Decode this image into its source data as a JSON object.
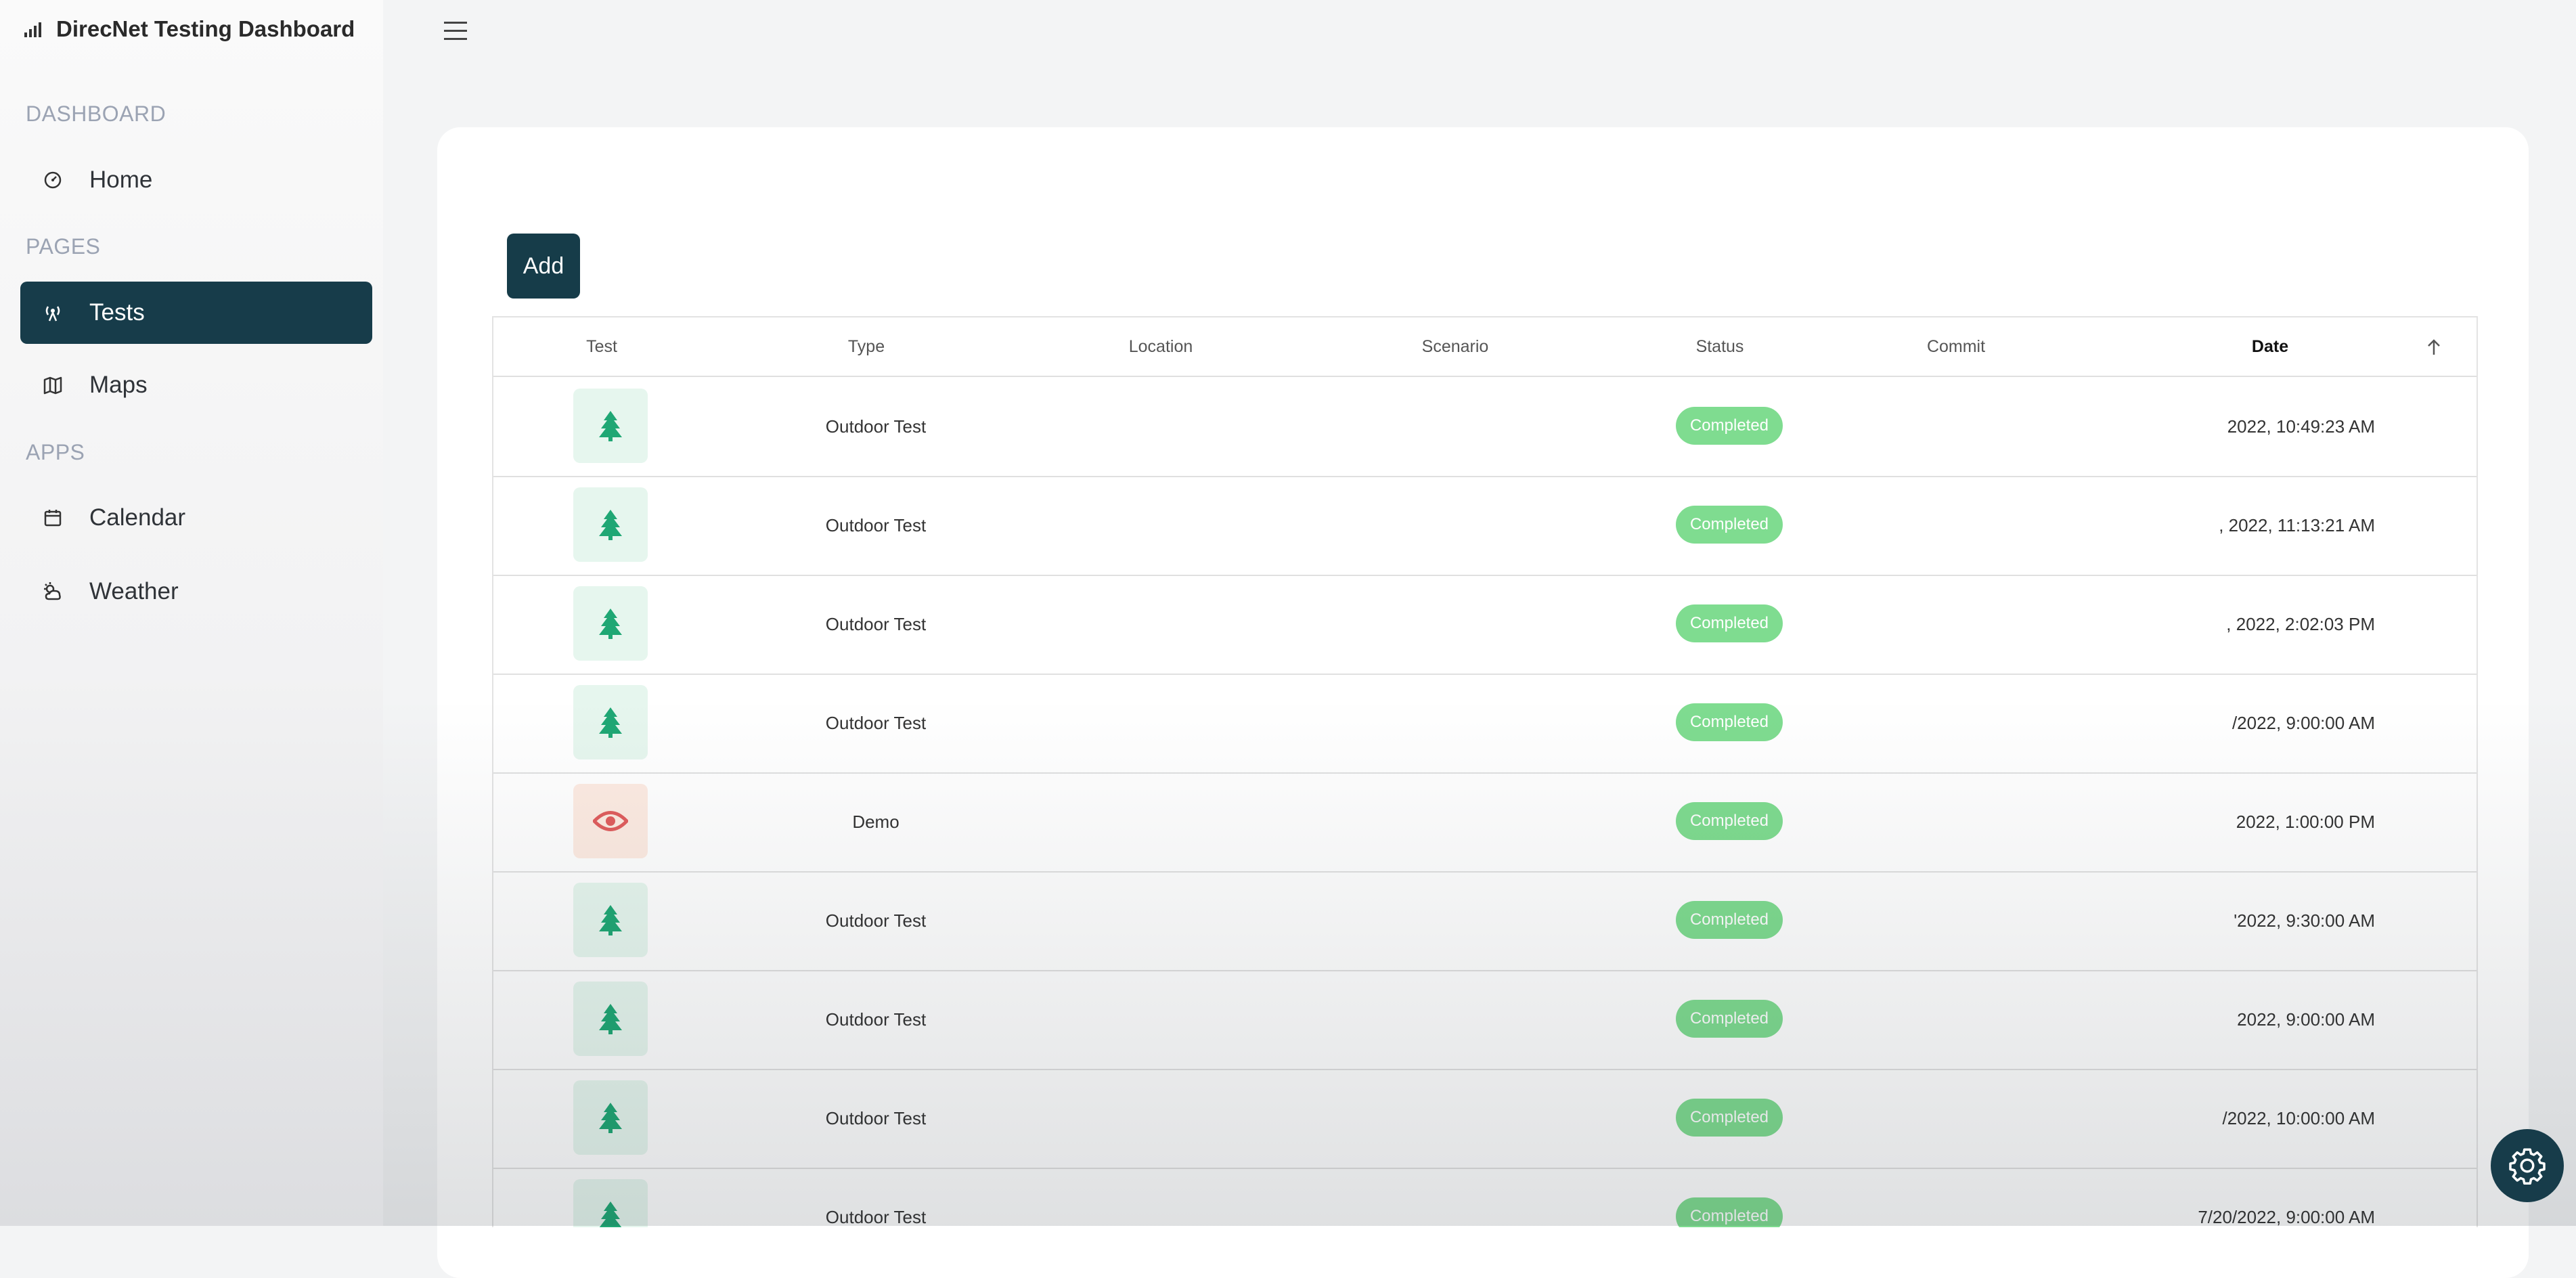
{
  "app": {
    "title": "DirecNet Testing Dashboard",
    "icon": "signal-bars-icon"
  },
  "sidebar": {
    "sections": [
      {
        "label": "DASHBOARD"
      },
      {
        "label": "PAGES"
      },
      {
        "label": "APPS"
      }
    ],
    "items": [
      {
        "label": "Home",
        "icon": "dashboard-gauge-icon",
        "active": false
      },
      {
        "label": "Tests",
        "icon": "antenna-icon",
        "active": true
      },
      {
        "label": "Maps",
        "icon": "map-icon",
        "active": false
      },
      {
        "label": "Calendar",
        "icon": "calendar-icon",
        "active": false
      },
      {
        "label": "Weather",
        "icon": "weather-icon",
        "active": false
      }
    ]
  },
  "toolbar": {
    "add_label": "Add"
  },
  "table": {
    "columns": [
      "Test",
      "Type",
      "Location",
      "Scenario",
      "Status",
      "Commit",
      "Date"
    ],
    "sorted_column": "Date",
    "sort_direction": "ascending",
    "rows": [
      {
        "icon": "tree-icon",
        "type": "Outdoor Test",
        "status": "Completed",
        "date": "2022, 10:49:23 AM"
      },
      {
        "icon": "tree-icon",
        "type": "Outdoor Test",
        "status": "Completed",
        "date": ", 2022, 11:13:21 AM"
      },
      {
        "icon": "tree-icon",
        "type": "Outdoor Test",
        "status": "Completed",
        "date": ", 2022, 2:02:03 PM"
      },
      {
        "icon": "tree-icon",
        "type": "Outdoor Test",
        "status": "Completed",
        "date": "/2022, 9:00:00 AM"
      },
      {
        "icon": "eye-icon",
        "type": "Demo",
        "status": "Completed",
        "date": "2022, 1:00:00 PM"
      },
      {
        "icon": "tree-icon",
        "type": "Outdoor Test",
        "status": "Completed",
        "date": "'2022, 9:30:00 AM"
      },
      {
        "icon": "tree-icon",
        "type": "Outdoor Test",
        "status": "Completed",
        "date": "2022, 9:00:00 AM"
      },
      {
        "icon": "tree-icon",
        "type": "Outdoor Test",
        "status": "Completed",
        "date": "/2022, 10:00:00 AM"
      },
      {
        "icon": "tree-icon",
        "type": "Outdoor Test",
        "status": "Completed",
        "date": "7/20/2022, 9:00:00 AM"
      }
    ]
  },
  "colors": {
    "primary": "#173c4a",
    "status_completed": "#7fdc90",
    "tree_icon": "#1fa774",
    "eye_icon": "#e05d5d"
  },
  "settings_button": {
    "icon": "gear-icon"
  }
}
